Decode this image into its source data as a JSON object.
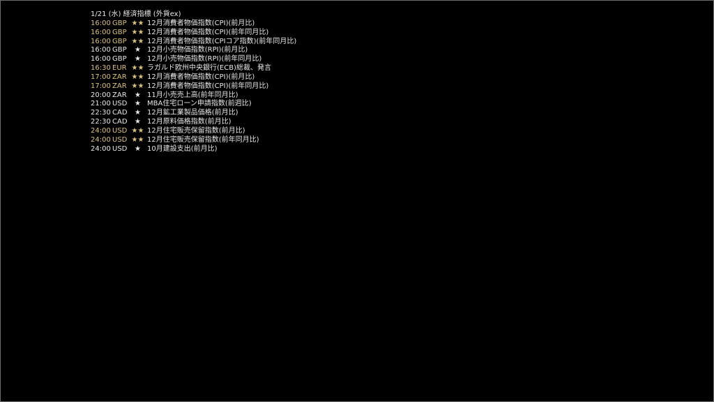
{
  "calendar": {
    "title": "1/21 (水) 経済指標 (外貨ex)",
    "colors": {
      "text": "#e8e8e8",
      "high_importance": "#d9c27a",
      "background": "#000000",
      "border": "#6e6e6e"
    },
    "events": [
      {
        "time": "16:00",
        "currency": "GBP",
        "stars": "★★",
        "event": "12月消費者物価指数(CPI)(前月比)",
        "level": "high"
      },
      {
        "time": "16:00",
        "currency": "GBP",
        "stars": "★★",
        "event": "12月消費者物価指数(CPI)(前年同月比)",
        "level": "high"
      },
      {
        "time": "16:00",
        "currency": "GBP",
        "stars": "★★",
        "event": "12月消費者物価指数(CPIコア指数)(前年同月比)",
        "level": "high"
      },
      {
        "time": "16:00",
        "currency": "GBP",
        "stars": "★",
        "event": "12月小売物価指数(RPI)(前月比)",
        "level": "low"
      },
      {
        "time": "16:00",
        "currency": "GBP",
        "stars": "★",
        "event": "12月小売物価指数(RPI)(前年同月比)",
        "level": "low"
      },
      {
        "time": "16:30",
        "currency": "EUR",
        "stars": "★★",
        "event": "ラガルド欧州中央銀行(ECB)総裁、発言",
        "level": "high"
      },
      {
        "time": "17:00",
        "currency": "ZAR",
        "stars": "★★",
        "event": "12月消費者物価指数(CPI)(前月比)",
        "level": "high"
      },
      {
        "time": "17:00",
        "currency": "ZAR",
        "stars": "★★",
        "event": "12月消費者物価指数(CPI)(前年同月比)",
        "level": "high"
      },
      {
        "time": "20:00",
        "currency": "ZAR",
        "stars": "★",
        "event": "11月小売売上高(前年同月比)",
        "level": "low"
      },
      {
        "time": "21:00",
        "currency": "USD",
        "stars": "★",
        "event": "MBA住宅ローン申請指数(前週比)",
        "level": "low"
      },
      {
        "time": "22:30",
        "currency": "CAD",
        "stars": "★",
        "event": "12月鉱工業製品価格(前月比)",
        "level": "low"
      },
      {
        "time": "22:30",
        "currency": "CAD",
        "stars": "★",
        "event": "12月原料価格指数(前月比)",
        "level": "low"
      },
      {
        "time": "24:00",
        "currency": "USD",
        "stars": "★★",
        "event": "12月住宅販売保留指数(前月比)",
        "level": "high"
      },
      {
        "time": "24:00",
        "currency": "USD",
        "stars": "★★",
        "event": "12月住宅販売保留指数(前年同月比)",
        "level": "high"
      },
      {
        "time": "24:00",
        "currency": "USD",
        "stars": "★",
        "event": "10月建設支出(前月比)",
        "level": "low"
      }
    ]
  }
}
